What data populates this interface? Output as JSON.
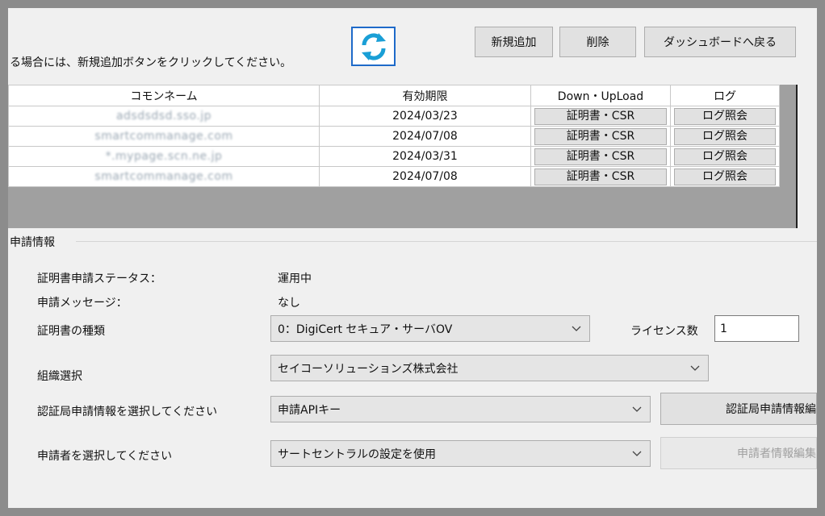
{
  "toolbar": {
    "instruction": "る場合には、新規追加ボタンをクリックしてください。",
    "refresh_icon": "refresh-icon",
    "new_label": "新規追加",
    "delete_label": "削除",
    "dashboard_label": "ダッシュボードへ戻る"
  },
  "table": {
    "headers": [
      "コモンネーム",
      "有効期限",
      "Down・UpLoad",
      "ログ"
    ],
    "rows": [
      {
        "name": "adsdsdsd.sso.jp",
        "expiry": "2024/03/23",
        "download": "証明書・CSR",
        "log": "ログ照会"
      },
      {
        "name": "smartcommanage.com",
        "expiry": "2024/07/08",
        "download": "証明書・CSR",
        "log": "ログ照会"
      },
      {
        "name": "*.mypage.scn.ne.jp",
        "expiry": "2024/03/31",
        "download": "証明書・CSR",
        "log": "ログ照会"
      },
      {
        "name": "smartcommanage.com",
        "expiry": "2024/07/08",
        "download": "証明書・CSR",
        "log": "ログ照会"
      }
    ]
  },
  "application": {
    "group_title": "申請情報",
    "status_label": "証明書申請ステータス：",
    "status_value": "運用中",
    "message_label": "申請メッセージ：",
    "message_value": "なし",
    "cert_type_label": "証明書の種類",
    "cert_type_value": "0：DigiCert セキュア・サーバOV",
    "license_label": "ライセンス数",
    "license_value": "1",
    "org_label": "組織選択",
    "org_value": "セイコーソリューションズ株式会社",
    "ca_label": "認証局申請情報を選択してください",
    "ca_value": "申請APIキー",
    "ca_button": "認証局申請情報編",
    "applicant_label": "申請者を選択してください",
    "applicant_value": "サートセントラルの設定を使用",
    "applicant_button": "申請者情報編集"
  }
}
